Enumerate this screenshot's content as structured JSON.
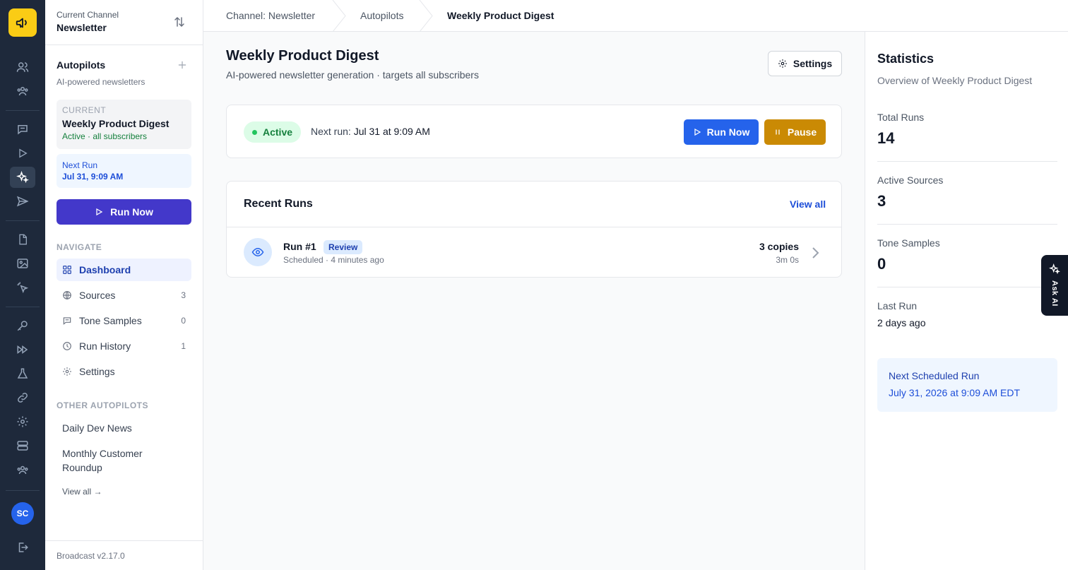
{
  "sidebar": {
    "channel_label": "Current Channel",
    "channel_name": "Newsletter",
    "autopilots_title": "Autopilots",
    "autopilots_sub": "AI-powered newsletters",
    "current_label": "CURRENT",
    "current_name": "Weekly Product Digest",
    "current_status": "Active · all subscribers",
    "next_run_label": "Next Run",
    "next_run_value": "Jul 31, 9:09 AM",
    "run_now": "Run Now",
    "navigate_label": "NAVIGATE",
    "nav": [
      {
        "label": "Dashboard",
        "count": "",
        "icon": "grid-icon"
      },
      {
        "label": "Sources",
        "count": "3",
        "icon": "globe-icon"
      },
      {
        "label": "Tone Samples",
        "count": "0",
        "icon": "message-icon"
      },
      {
        "label": "Run History",
        "count": "1",
        "icon": "clock-icon"
      },
      {
        "label": "Settings",
        "count": "",
        "icon": "gear-icon"
      }
    ],
    "other_label": "OTHER AUTOPILOTS",
    "others": [
      "Daily Dev News",
      "Monthly Customer Roundup"
    ],
    "view_all": "View all →",
    "version": "Broadcast v2.17.0"
  },
  "rail": {
    "avatar": "SC"
  },
  "breadcrumb": [
    "Channel: Newsletter",
    "Autopilots",
    "Weekly Product Digest"
  ],
  "main": {
    "title": "Weekly Product Digest",
    "subtitle": "AI-powered newsletter generation · targets all subscribers",
    "settings": "Settings",
    "status": "Active",
    "next_run_prefix": "Next run:",
    "next_run_value": "Jul 31 at 9:09 AM",
    "run_now": "Run Now",
    "pause": "Pause",
    "recent_runs_title": "Recent Runs",
    "view_all": "View all",
    "runs": [
      {
        "name": "Run #1",
        "badge": "Review",
        "meta": "Scheduled · 4 minutes ago",
        "copies": "3 copies",
        "duration": "3m 0s"
      }
    ]
  },
  "stats": {
    "title": "Statistics",
    "subtitle": "Overview of Weekly Product Digest",
    "items": [
      {
        "label": "Total Runs",
        "value": "14"
      },
      {
        "label": "Active Sources",
        "value": "3"
      },
      {
        "label": "Tone Samples",
        "value": "0"
      },
      {
        "label": "Last Run",
        "value": "2 days ago"
      }
    ],
    "scheduled_title": "Next Scheduled Run",
    "scheduled_value": "July 31, 2026 at 9:09 AM EDT"
  },
  "ask_ai": "Ask AI",
  "colors": {
    "rail_bg": "#1e293b",
    "brand_yellow": "#facc15",
    "primary_blue": "#2563eb",
    "indigo": "#4338ca",
    "pause_gold": "#ca8a04",
    "active_green": "#15803d"
  }
}
